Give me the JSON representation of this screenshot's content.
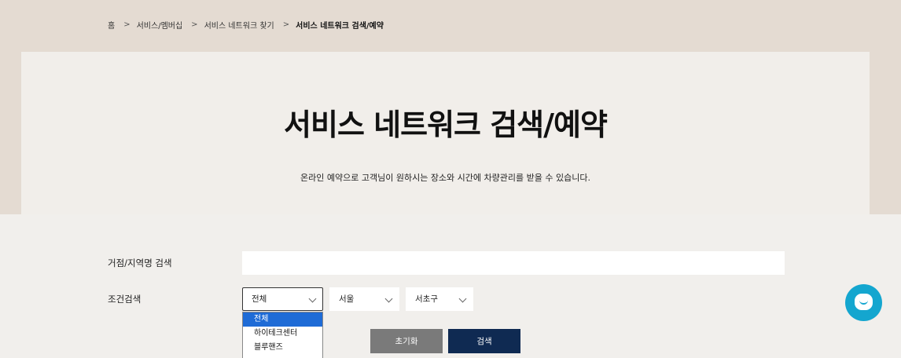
{
  "breadcrumb": {
    "home": "홈",
    "items": [
      "서비스/멤버십",
      "서비스 네트워크 찾기",
      "서비스 네트워크 검색/예약"
    ],
    "separator": ">"
  },
  "hero": {
    "title": "서비스 네트워크 검색/예약",
    "description": "온라인 예약으로 고객님이 원하시는 장소와 시간에 차량관리를 받을 수 있습니다."
  },
  "form": {
    "location_label": "거점/지역명 검색",
    "location_value": "",
    "condition_label": "조건검색",
    "type_select": "전체",
    "city_select": "서울",
    "district_select": "서초구",
    "dropdown_options": [
      "전체",
      "하이테크센터",
      "블루핸즈"
    ],
    "dropdown_selected": "전체"
  },
  "buttons": {
    "reset": "초기화",
    "search": "검색"
  },
  "colors": {
    "hero_bg": "#e4dbd2",
    "card_bg": "#f1eeea",
    "search_button": "#0f2a52",
    "reset_button": "#7a7a7a",
    "chat_button": "#14a6cf",
    "dropdown_highlight": "#1e6bd6"
  },
  "icons": {
    "chat": "chat-bubble-icon",
    "select": "chevron-down-icon",
    "breadcrumb": "chevron-right-icon"
  }
}
